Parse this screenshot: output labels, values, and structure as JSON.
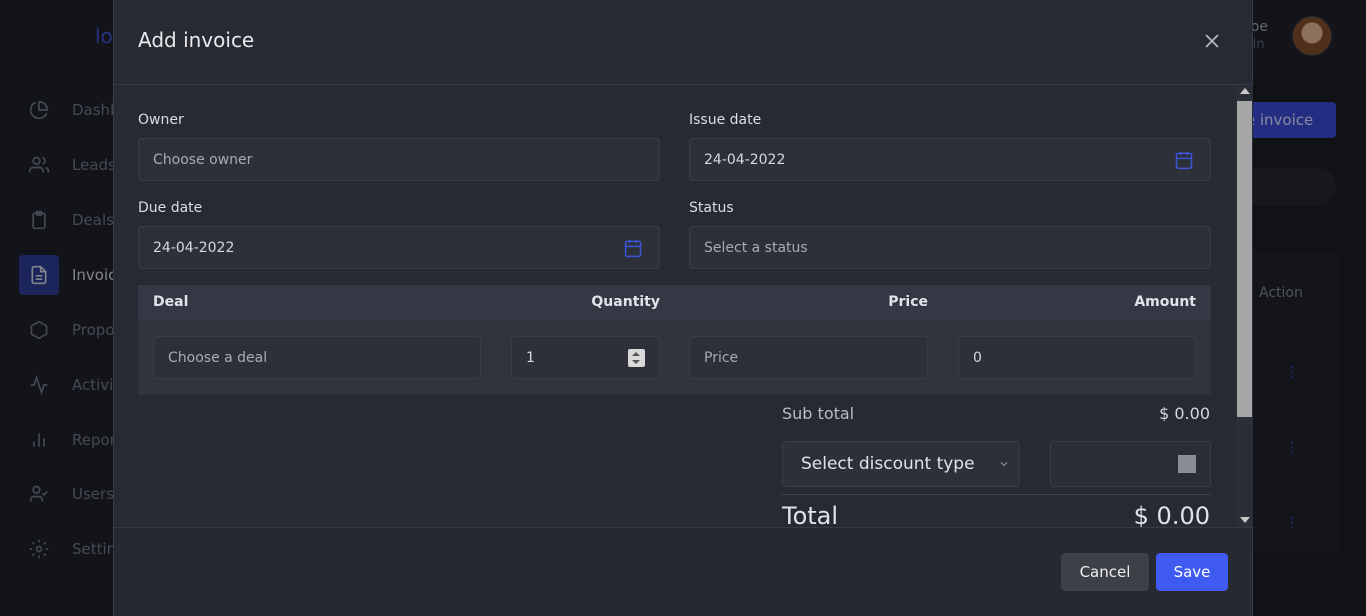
{
  "background": {
    "logo": "lo",
    "user": {
      "name": "Doe",
      "role": "min"
    },
    "sidebar": [
      {
        "label": "Dashb",
        "icon": "chart-pie-icon"
      },
      {
        "label": "Leads",
        "icon": "users-icon"
      },
      {
        "label": "Deals",
        "icon": "clipboard-icon"
      },
      {
        "label": "Invoic",
        "icon": "file-text-icon",
        "active": true
      },
      {
        "label": "Propo",
        "icon": "hexagon-icon"
      },
      {
        "label": "Activi",
        "icon": "activity-icon"
      },
      {
        "label": "Repor",
        "icon": "bar-chart-icon"
      },
      {
        "label": "Users",
        "icon": "user-check-icon"
      },
      {
        "label": "Settin",
        "icon": "gear-icon"
      }
    ],
    "create_button": "te invoice",
    "table_header": "Action"
  },
  "modal": {
    "title": "Add invoice",
    "owner": {
      "label": "Owner",
      "placeholder": "Choose owner"
    },
    "issue_date": {
      "label": "Issue date",
      "value": "24-04-2022"
    },
    "due_date": {
      "label": "Due date",
      "value": "24-04-2022"
    },
    "status": {
      "label": "Status",
      "placeholder": "Select a status"
    },
    "items": {
      "headers": {
        "deal": "Deal",
        "quantity": "Quantity",
        "price": "Price",
        "amount": "Amount"
      },
      "row": {
        "deal_placeholder": "Choose a deal",
        "quantity": "1",
        "price_placeholder": "Price",
        "amount": "0"
      }
    },
    "subtotal": {
      "label": "Sub total",
      "value": "$ 0.00"
    },
    "discount": {
      "placeholder": "Select discount type"
    },
    "total": {
      "label": "Total",
      "value": "$ 0.00"
    },
    "buttons": {
      "cancel": "Cancel",
      "save": "Save"
    }
  },
  "colors": {
    "accent": "#3e5af0",
    "modal_bg": "#272a33",
    "calendar_icon": "#3b55d9"
  }
}
